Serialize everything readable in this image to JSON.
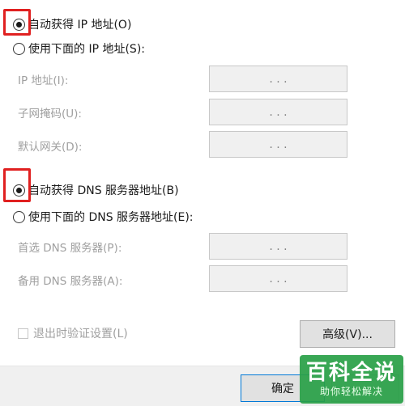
{
  "ip_section": {
    "auto_label": "自动获得 IP 地址(O)",
    "manual_label": "使用下面的 IP 地址(S):",
    "fields": [
      {
        "label": "IP 地址(I):",
        "value": ".   .   ."
      },
      {
        "label": "子网掩码(U):",
        "value": ".   .   ."
      },
      {
        "label": "默认网关(D):",
        "value": ".   .   ."
      }
    ]
  },
  "dns_section": {
    "auto_label": "自动获得 DNS 服务器地址(B)",
    "manual_label": "使用下面的 DNS 服务器地址(E):",
    "fields": [
      {
        "label": "首选 DNS 服务器(P):",
        "value": ".   .   ."
      },
      {
        "label": "备用 DNS 服务器(A):",
        "value": ".   .   ."
      }
    ]
  },
  "validate_label": "退出时验证设置(L)",
  "advanced_button": "高级(V)...",
  "ok_button": "确定",
  "watermark": {
    "title": "百科全说",
    "subtitle": "助你轻松解决"
  },
  "colors": {
    "highlight": "#e02020",
    "brand": "#28a046"
  }
}
